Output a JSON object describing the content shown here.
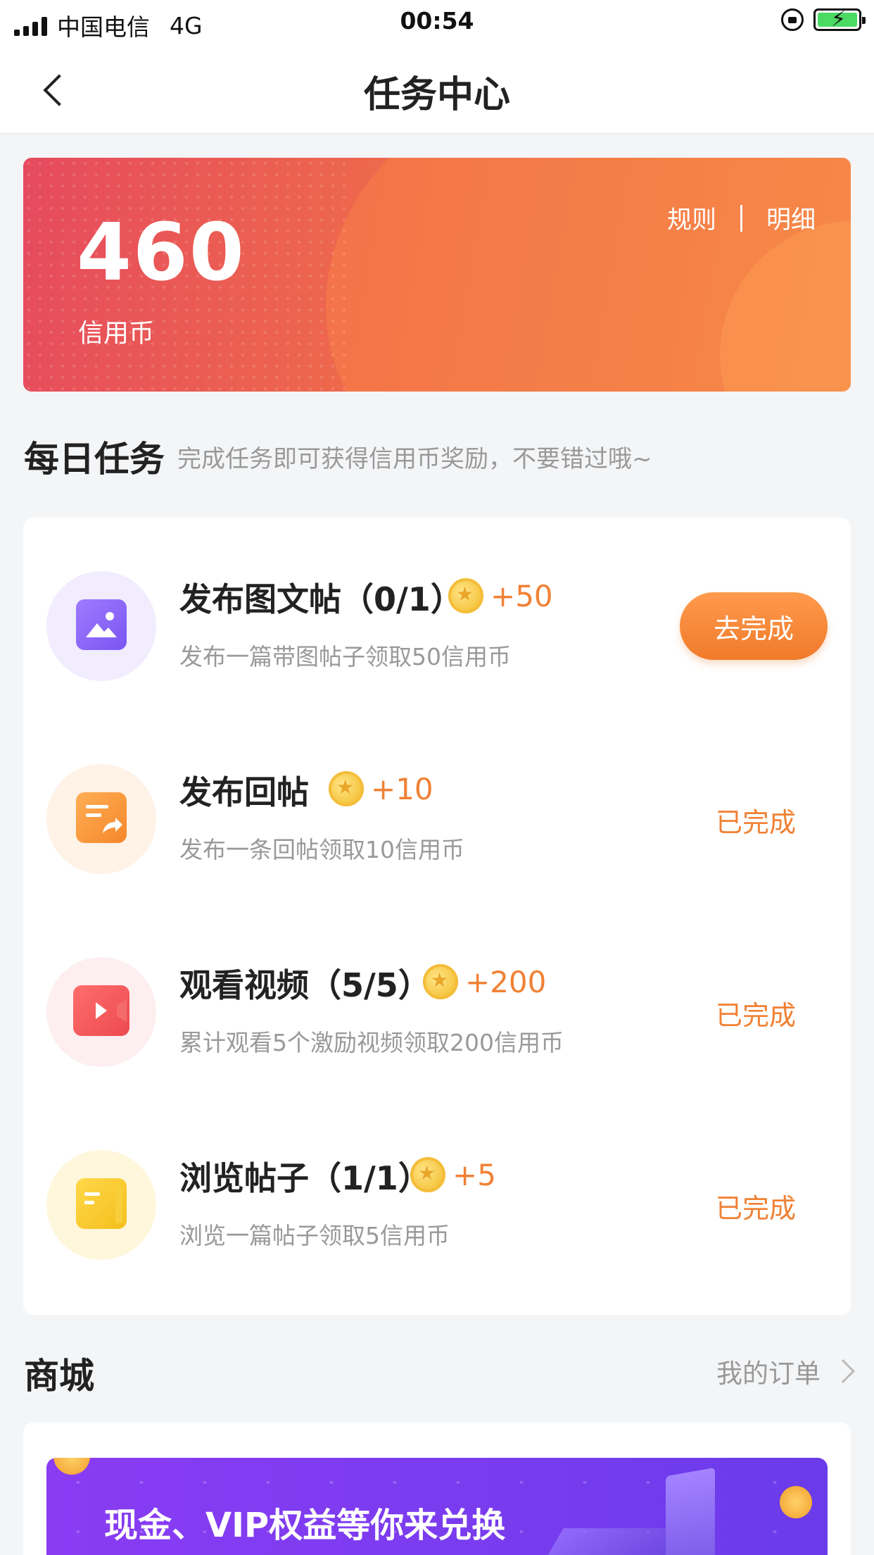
{
  "status_bar": {
    "carrier": "中国电信",
    "network": "4G",
    "time": "00:54"
  },
  "nav": {
    "title": "任务中心"
  },
  "credit_card": {
    "amount": "460",
    "label": "信用币",
    "rules": "规则",
    "details": "明细"
  },
  "daily": {
    "title": "每日任务",
    "subtitle": "完成任务即可获得信用币奖励，不要错过哦~",
    "tasks": [
      {
        "title": "发布图文帖（0/1）",
        "reward": "+50",
        "desc": "发布一篇带图帖子领取50信用币",
        "action": "去完成",
        "icon": "image-icon"
      },
      {
        "title": "发布回帖",
        "reward": "+10",
        "desc": "发布一条回帖领取10信用币",
        "action": "已完成",
        "icon": "reply-icon"
      },
      {
        "title": "观看视频（5/5）",
        "reward": "+200",
        "desc": "累计观看5个激励视频领取200信用币",
        "action": "已完成",
        "icon": "video-icon"
      },
      {
        "title": "浏览帖子（1/1）",
        "reward": "+5",
        "desc": "浏览一篇帖子领取5信用币",
        "action": "已完成",
        "icon": "document-icon"
      }
    ]
  },
  "shop": {
    "title": "商城",
    "orders": "我的订单",
    "banner_text": "现金、VIP权益等你来兑换"
  },
  "colors": {
    "accent": "#f08135",
    "card_gradient_start": "#e64a5e",
    "card_gradient_end": "#f2874a",
    "banner_purple": "#7b3cef"
  }
}
